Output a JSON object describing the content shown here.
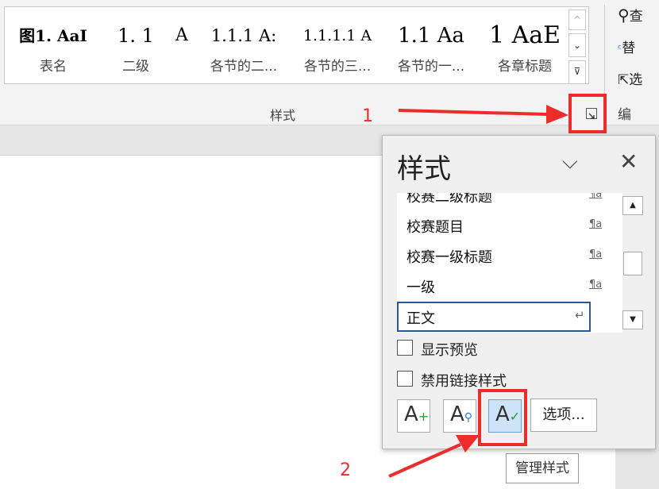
{
  "ribbon": {
    "gallery_items": [
      {
        "preview": "图1. AaI",
        "name": "表名"
      },
      {
        "preview": "1. 1",
        "name": "二级"
      },
      {
        "preview": "A",
        "name": ""
      },
      {
        "preview": "1.1.1 A:",
        "name": "各节的二..."
      },
      {
        "preview": "1.1.1.1 A",
        "name": "各节的三..."
      },
      {
        "preview": "1.1 Aa",
        "name": "各节的一..."
      },
      {
        "preview": "1 AaE",
        "name": "各章标题"
      }
    ],
    "group_label": "样式",
    "edit_items": [
      {
        "icon": "search-icon",
        "label": "查"
      },
      {
        "icon": "replace-icon",
        "label": "替"
      },
      {
        "icon": "select-icon",
        "label": "选"
      },
      {
        "icon": "",
        "label": "编"
      }
    ]
  },
  "styles_pane": {
    "title": "样式",
    "items": [
      {
        "label": "校赛二级标题",
        "mark": "¶a"
      },
      {
        "label": "校赛题目",
        "mark": "¶a"
      },
      {
        "label": "校赛一级标题",
        "mark": "¶a"
      },
      {
        "label": "一级",
        "mark": "¶a"
      },
      {
        "label": "正文",
        "mark": "↵",
        "selected": true
      }
    ],
    "show_preview_label": "显示预览",
    "disable_linked_label": "禁用链接样式",
    "options_label": "选项...",
    "tooltip": "管理样式"
  },
  "annotations": {
    "step1": "1",
    "step2": "2",
    "color": "#ee2c2c"
  }
}
